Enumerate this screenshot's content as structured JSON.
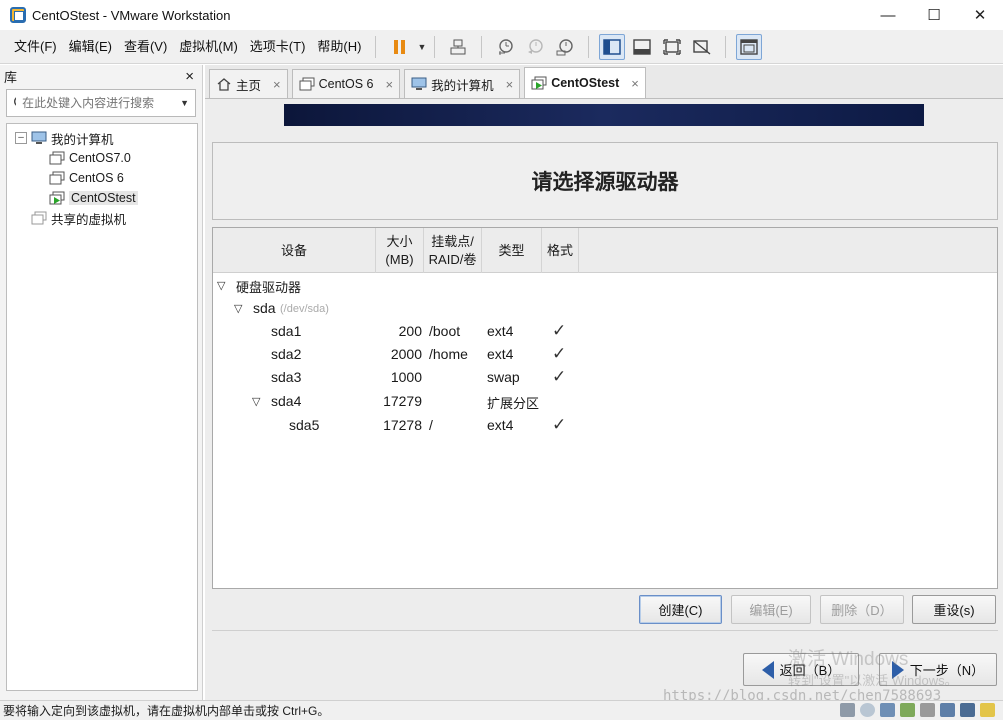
{
  "window": {
    "title": "CentOStest - VMware Workstation"
  },
  "menu": {
    "items": [
      "文件(F)",
      "编辑(E)",
      "查看(V)",
      "虚拟机(M)",
      "选项卡(T)",
      "帮助(H)"
    ]
  },
  "library": {
    "title": "库",
    "close": "×",
    "search_placeholder": "在此处键入内容进行搜索",
    "tree": {
      "root": "我的计算机",
      "vms": [
        "CentOS7.0",
        "CentOS 6",
        "CentOStest"
      ],
      "shared": "共享的虚拟机"
    }
  },
  "tabs": [
    {
      "label": "主页"
    },
    {
      "label": "CentOS 6"
    },
    {
      "label": "我的计算机"
    },
    {
      "label": "CentOStest"
    }
  ],
  "tab_close": "×",
  "installer": {
    "heading": "请选择源驱动器",
    "columns": {
      "device": "设备",
      "size_1": "大小",
      "size_2": "(MB)",
      "mount_1": "挂载点/",
      "mount_2": "RAID/卷",
      "type": "类型",
      "format": "格式"
    },
    "group": "硬盘驱动器",
    "disk": {
      "name": "sda",
      "path": "(/dev/sda)"
    },
    "partitions": [
      {
        "name": "sda1",
        "size": "200",
        "mount": "/boot",
        "type": "ext4",
        "format": "✓"
      },
      {
        "name": "sda2",
        "size": "2000",
        "mount": "/home",
        "type": "ext4",
        "format": "✓"
      },
      {
        "name": "sda3",
        "size": "1000",
        "mount": "",
        "type": "swap",
        "format": "✓"
      },
      {
        "name": "sda4",
        "size": "17279",
        "mount": "",
        "type": "扩展分区",
        "format": ""
      },
      {
        "name": "sda5",
        "size": "17278",
        "mount": "/",
        "type": "ext4",
        "format": "✓"
      }
    ],
    "buttons": {
      "create": "创建(C)",
      "edit": "编辑(E)",
      "delete": "删除（D）",
      "reset": "重设(s)",
      "back": "返回（B）",
      "next": "下一步（N）"
    }
  },
  "watermark": {
    "activate": "激活 Windows",
    "activate_hint": "转到\"设置\"以激活 Windows。",
    "url": "https://blog.csdn.net/chen7588693"
  },
  "statusbar": {
    "text": "要将输入定向到该虚拟机，请在虚拟机内部单击或按 Ctrl+G。"
  }
}
